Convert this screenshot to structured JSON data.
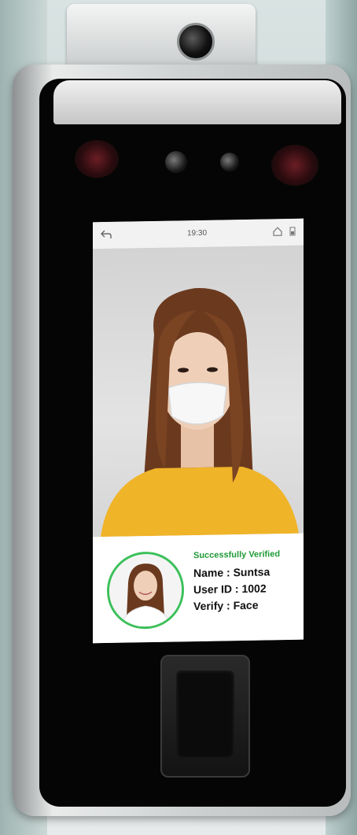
{
  "screen": {
    "status_bar": {
      "time": "19:30"
    },
    "result": {
      "status": "Successfully Verified",
      "name": "Name : Suntsa",
      "user_id": "User ID : 1002",
      "verify": "Verify : Face"
    }
  },
  "colors": {
    "success_green": "#1e9a35",
    "avatar_ring": "#3cc05a",
    "device_face": "#050505",
    "shirt_yellow": "#f0b429"
  }
}
